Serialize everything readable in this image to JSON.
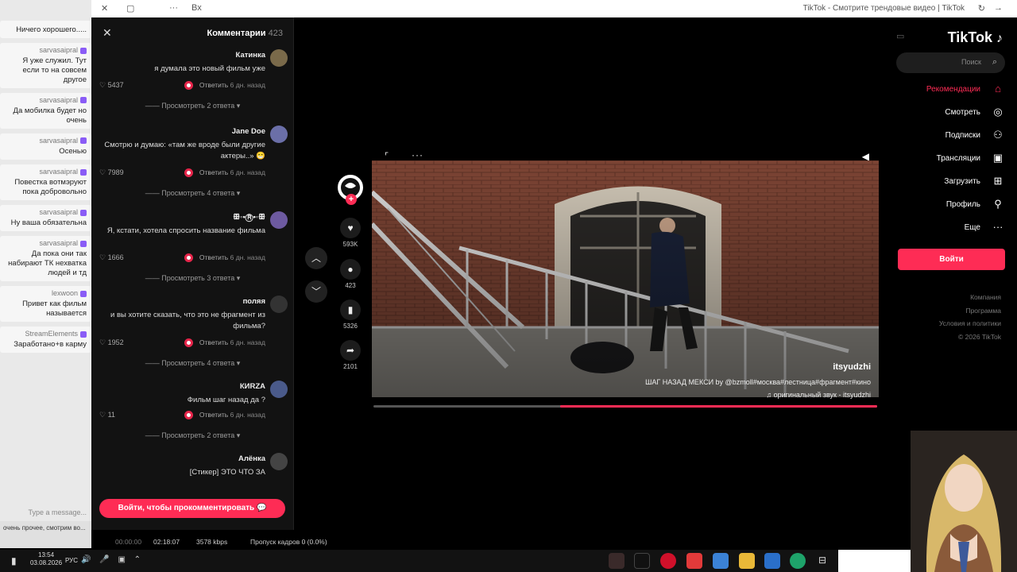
{
  "browser": {
    "title": "TikTok - Смотрите трендовые видео | TikTok",
    "tab_icon": "Вх"
  },
  "chat": {
    "messages": [
      {
        "user": "",
        "text": "Ничего хорошего....."
      },
      {
        "user": "sarvasaipral",
        "text": "Я уже служил. Тут если то на совсем другое"
      },
      {
        "user": "sarvasaipral",
        "text": "Да мобилка будет но очень"
      },
      {
        "user": "sarvasaipral",
        "text": "Осенью"
      },
      {
        "user": "sarvasaipral",
        "text": "Повестка вотмэруют пока добровольно"
      },
      {
        "user": "sarvasaipral",
        "text": "Ну ваша обязательна"
      },
      {
        "user": "sarvasaipral",
        "text": "Да пока они так набирают ТК нехватка людей и тд"
      },
      {
        "user": "lexwoon",
        "text": "Привет как фильм называется"
      },
      {
        "user": "StreamElements",
        "text": "Заработано+в карму"
      }
    ],
    "input_placeholder": "Type a message...",
    "bottom_text": "очень прочее, смотрим во..."
  },
  "comments": {
    "title": "Комментарии",
    "count": "423",
    "items": [
      {
        "author": "Катинка",
        "text": "я думала это новый фильм уже",
        "date": "6 дн. назад",
        "reply": "Ответить",
        "likes": "♡ 5437",
        "replies": "Просмотреть 2 ответа"
      },
      {
        "author": "Jane Doe",
        "text": "Смотрю и думаю: «там же вроде были другие актеры..» 😁",
        "date": "6 дн. назад",
        "reply": "Ответить",
        "likes": "♡ 7989",
        "replies": "Просмотреть 4 ответа"
      },
      {
        "author": "ꕥ⁠◦⁠•⁠Ⓡ⁠•⁠◦ꕥ",
        "text": "Я, кстати, хотела спросить название фильма",
        "date": "6 дн. назад",
        "reply": "Ответить",
        "likes": "♡ 1666",
        "replies": "Просмотреть 3 ответа"
      },
      {
        "author": "поляя",
        "text": "и вы хотите сказать, что это не фрагмент из фильма?",
        "date": "6 дн. назад",
        "reply": "Ответить",
        "likes": "♡ 1952",
        "replies": "Просмотреть 4 ответа"
      },
      {
        "author": "КИRZА",
        "text": "Фильм шаг назад да ?",
        "date": "6 дн. назад",
        "reply": "Ответить",
        "likes": "♡ 11",
        "replies": "Просмотреть 2 ответа"
      },
      {
        "author": "Алёнка",
        "text": "[Стикер] ЭТО ЧТО ЗА",
        "date": "",
        "reply": "",
        "likes": "",
        "replies": ""
      }
    ],
    "login_cta": "Войти, чтобы прокомментировать"
  },
  "video": {
    "author": "itsyudzhi",
    "description": "ШАГ НАЗАД МЕКСИ by @bzmoll#москва#лестница#фрагмент#кино",
    "sound": "♫ оригинальный звук - itsyudzhi",
    "progress": 0.63
  },
  "actions": [
    {
      "name": "like",
      "icon": "♥",
      "count": "593K"
    },
    {
      "name": "comment",
      "icon": "●",
      "count": "423"
    },
    {
      "name": "save",
      "icon": "▮",
      "count": "5326"
    },
    {
      "name": "share",
      "icon": "➦",
      "count": "2101"
    }
  ],
  "tiktok": {
    "logo": "TikTok",
    "search_placeholder": "Поиск",
    "nav": [
      {
        "label": "Рекомендации",
        "icon": "⌂",
        "active": true
      },
      {
        "label": "Смотреть",
        "icon": "◎",
        "active": false
      },
      {
        "label": "Подписки",
        "icon": "⚇",
        "active": false
      },
      {
        "label": "Трансляции",
        "icon": "▣",
        "active": false
      },
      {
        "label": "Загрузить",
        "icon": "⊞",
        "active": false
      },
      {
        "label": "Профиль",
        "icon": "⚲",
        "active": false
      },
      {
        "label": "Еще",
        "icon": "···",
        "active": false
      }
    ],
    "login": "Войти",
    "links": [
      "Компания",
      "Программа",
      "Условия и политики",
      "© 2026 TikTok"
    ]
  },
  "stats": {
    "skipped": "Пропуск кадров 0 (0.0%)",
    "bitrate": "3578 kbps",
    "time": "02:18:07",
    "duration": "00:00:00"
  },
  "taskbar": {
    "time": "13:54",
    "date": "03.08.2026",
    "lang": "РУС"
  },
  "colors": {
    "accent": "#fe2c55",
    "background": "#000000",
    "panel": "#121212"
  }
}
